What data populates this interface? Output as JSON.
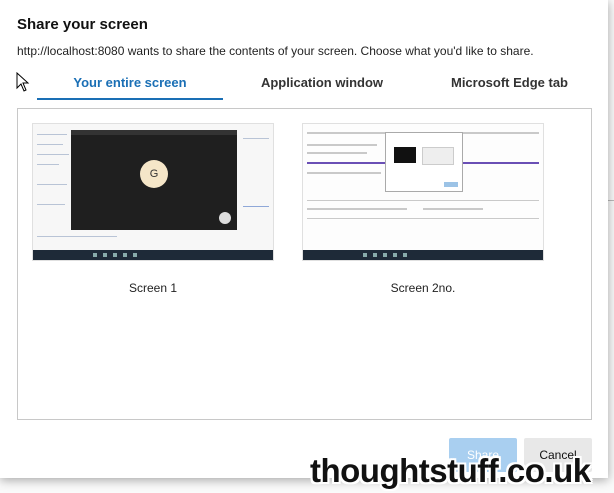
{
  "dialog": {
    "title": "Share your screen",
    "subtitle": "http://localhost:8080 wants to share the contents of your screen. Choose what you'd like to share."
  },
  "tabs": [
    {
      "label": "Your entire screen",
      "active": true
    },
    {
      "label": "Application window",
      "active": false
    },
    {
      "label": "Microsoft Edge tab",
      "active": false
    }
  ],
  "screens": [
    {
      "label": "Screen 1",
      "thumbnail_avatar": "G"
    },
    {
      "label": "Screen 2no."
    }
  ],
  "buttons": {
    "share": "Share",
    "cancel": "Cancel"
  },
  "watermark": "thoughtstuff.co.uk",
  "colors": {
    "accent": "#1a6fb5",
    "share_disabled": "#a9cff0",
    "cancel_bg": "#e8e8e8"
  },
  "icons": {
    "cursor": "mouse-pointer-icon"
  }
}
